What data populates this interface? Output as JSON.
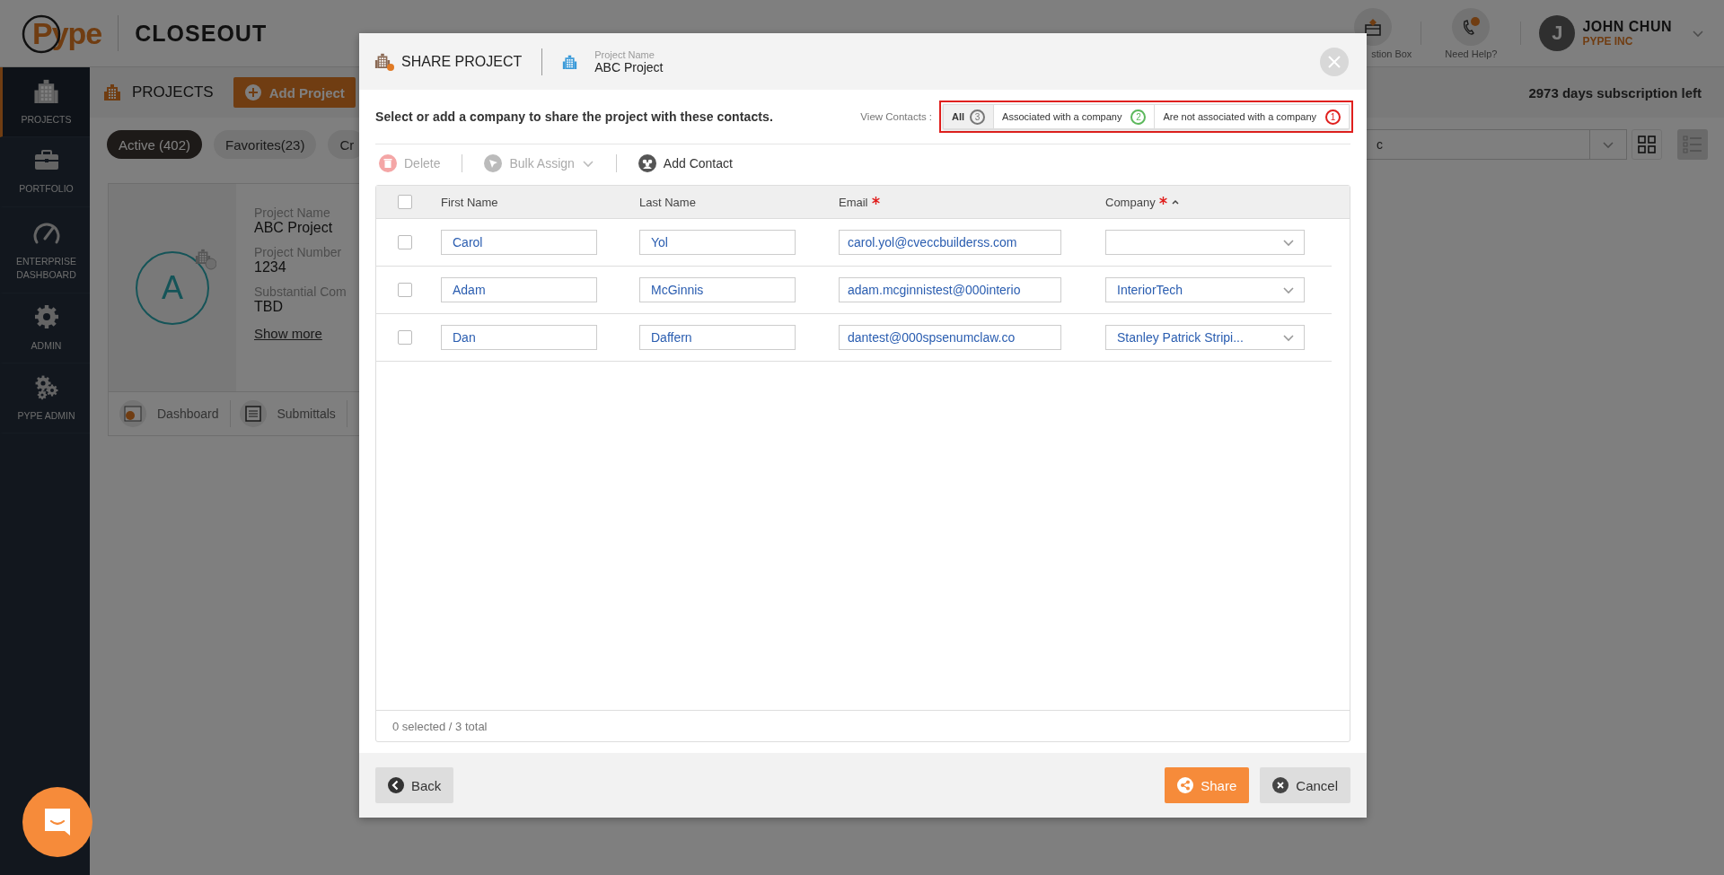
{
  "header": {
    "logo": "Pype",
    "product": "CLOSEOUT",
    "actions": [
      {
        "kind": "question-box",
        "label": "stion Box"
      },
      {
        "kind": "help",
        "label": "Need Help?"
      }
    ],
    "user": {
      "initial": "J",
      "name": "JOHN CHUN",
      "company": "PYPE INC"
    }
  },
  "sidebar": {
    "items": [
      {
        "kind": "projects",
        "label": "PROJECTS",
        "selected": true
      },
      {
        "kind": "portfolio",
        "label": "PORTFOLIO",
        "selected": false
      },
      {
        "kind": "dashboard",
        "label": "ENTERPRISE DASHBOARD",
        "selected": false
      },
      {
        "kind": "admin",
        "label": "ADMIN",
        "selected": false
      },
      {
        "kind": "pype-admin",
        "label": "PYPE ADMIN",
        "selected": false
      }
    ]
  },
  "page": {
    "title": "PROJECTS",
    "add_button": "Add Project",
    "subscription": "2973 days subscription left",
    "filters": [
      {
        "label": "Active (402)",
        "selected": true
      },
      {
        "label": "Favorites(23)",
        "selected": false
      },
      {
        "label": "Cr",
        "selected": false
      }
    ],
    "sort_select": {
      "value": "c"
    },
    "views": [
      {
        "kind": "grid",
        "selected": true
      },
      {
        "kind": "list",
        "selected": false
      }
    ],
    "project_card": {
      "initial": "A",
      "fields": [
        {
          "label": "Project Name",
          "value": "ABC Project"
        },
        {
          "label": "Project Number",
          "value": "1234"
        },
        {
          "label": "Substantial Com",
          "value": "TBD"
        }
      ],
      "link": "Show more",
      "tabs": [
        {
          "kind": "dashboard",
          "label": "Dashboard"
        },
        {
          "kind": "submittals",
          "label": "Submittals"
        }
      ]
    }
  },
  "modal": {
    "title": "SHARE PROJECT",
    "project_label": "Project Name",
    "project_name": "ABC Project",
    "instruction": "Select or add a company to share the project with these contacts.",
    "view_contacts_label": "View Contacts :",
    "view_filters": [
      {
        "label": "All",
        "count": "3",
        "color": "#777777",
        "selected": true
      },
      {
        "label": "Associated with a company",
        "count": "2",
        "color": "#5cb85c",
        "selected": false
      },
      {
        "label": "Are not associated with a company",
        "count": "1",
        "color": "#e0201e",
        "selected": false
      }
    ],
    "toolbar": [
      {
        "kind": "delete",
        "label": "Delete",
        "disabled": true
      },
      {
        "kind": "bulk-assign",
        "label": "Bulk Assign",
        "disabled": true
      },
      {
        "kind": "add-contact",
        "label": "Add Contact",
        "disabled": false
      }
    ],
    "select_all": {
      "checked": false
    },
    "columns": [
      {
        "label": "First Name",
        "required": false,
        "sorted_ascending": false
      },
      {
        "label": "Last Name",
        "required": false,
        "sorted_ascending": false
      },
      {
        "label": "Email",
        "required": true,
        "sorted_ascending": false
      },
      {
        "label": "Company",
        "required": true,
        "sorted_ascending": true
      }
    ],
    "rows": [
      {
        "checked": false,
        "first_name": "Carol",
        "last_name": "Yol",
        "email": "carol.yol@cveccbuilderss.com"
      },
      {
        "checked": false,
        "first_name": "Adam",
        "last_name": "McGinnis",
        "email": "adam.mcginnistest@000interio",
        "company": "InteriorTech"
      },
      {
        "checked": false,
        "first_name": "Dan",
        "last_name": "Daffern",
        "email": "dantest@000spsenumclaw.co",
        "company": "Stanley Patrick Stripi..."
      }
    ],
    "footer_status": "0 selected / 3 total",
    "buttons": [
      {
        "kind": "back",
        "label": "Back"
      },
      {
        "kind": "share",
        "label": "Share"
      },
      {
        "kind": "cancel",
        "label": "Cancel"
      }
    ]
  }
}
